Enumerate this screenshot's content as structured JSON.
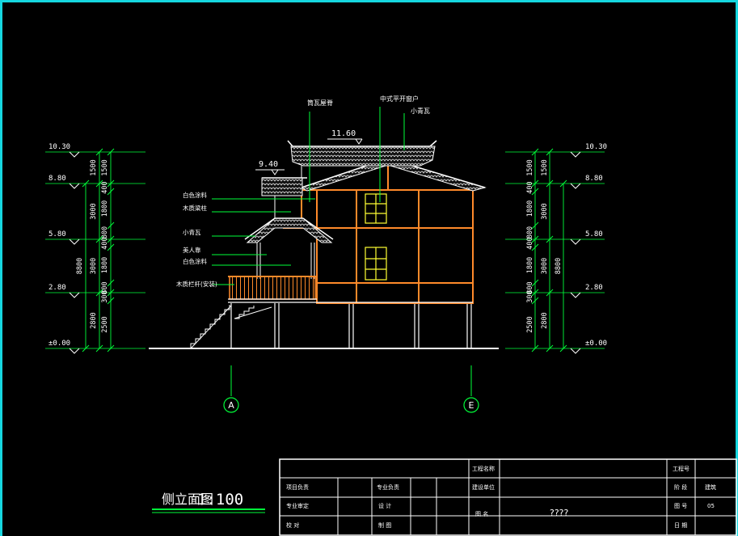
{
  "drawing": {
    "title": "侧立面图",
    "scale": "1:100",
    "colors": {
      "background": "#000000",
      "frame": "#16d7e0",
      "dimension": "#00ff3a",
      "text": "#ffffff",
      "structure": "#ff8a2a",
      "roof": "#ffffff",
      "window": "#ffff33",
      "elevation": "#ffffff"
    }
  },
  "elevations_left": [
    "10.30",
    "8.80",
    "5.80",
    "2.80",
    "±0.00"
  ],
  "elevations_right": [
    "10.30",
    "8.80",
    "5.80",
    "2.80",
    "±0.00"
  ],
  "roof_levels": [
    "11.60",
    "9.40"
  ],
  "dims_inner_left": [
    "1500",
    "400",
    "1800",
    "800",
    "400",
    "1800",
    "800",
    "300",
    "2500"
  ],
  "dims_mid_left": [
    "1500",
    "3000",
    "3000",
    "2800"
  ],
  "dims_outer_left": [
    "8800"
  ],
  "dims_inner_right": [
    "1500",
    "400",
    "1800",
    "800",
    "400",
    "1800",
    "800",
    "300",
    "2500"
  ],
  "dims_mid_right": [
    "1500",
    "3000",
    "3000",
    "2800"
  ],
  "dims_outer_right": [
    "8800"
  ],
  "annotations": {
    "top": [
      "筒瓦屋脊",
      "中式平开窗户",
      "小青瓦"
    ],
    "left": [
      "白色涂料",
      "木质梁柱",
      "小青瓦",
      "美人靠",
      "白色涂料",
      "木质栏杆(安装)"
    ]
  },
  "axes": [
    "A",
    "E"
  ],
  "title_block": {
    "project_name_label": "工程名称",
    "project_no_label": "工程号",
    "project_lead_label": "项目负责",
    "discipline_lead_label": "专业负责",
    "construction_unit_label": "建设单位",
    "stage_label": "阶 段",
    "stage_value": "建筑",
    "review_label": "专业审定",
    "design_label": "设 计",
    "drawing_name_label": "图 名",
    "drawing_name_value": "????",
    "sheet_no_label": "图 号",
    "sheet_no_value": "05",
    "check_label": "校 对",
    "draft_label": "制 图",
    "date_label": "日 期"
  }
}
